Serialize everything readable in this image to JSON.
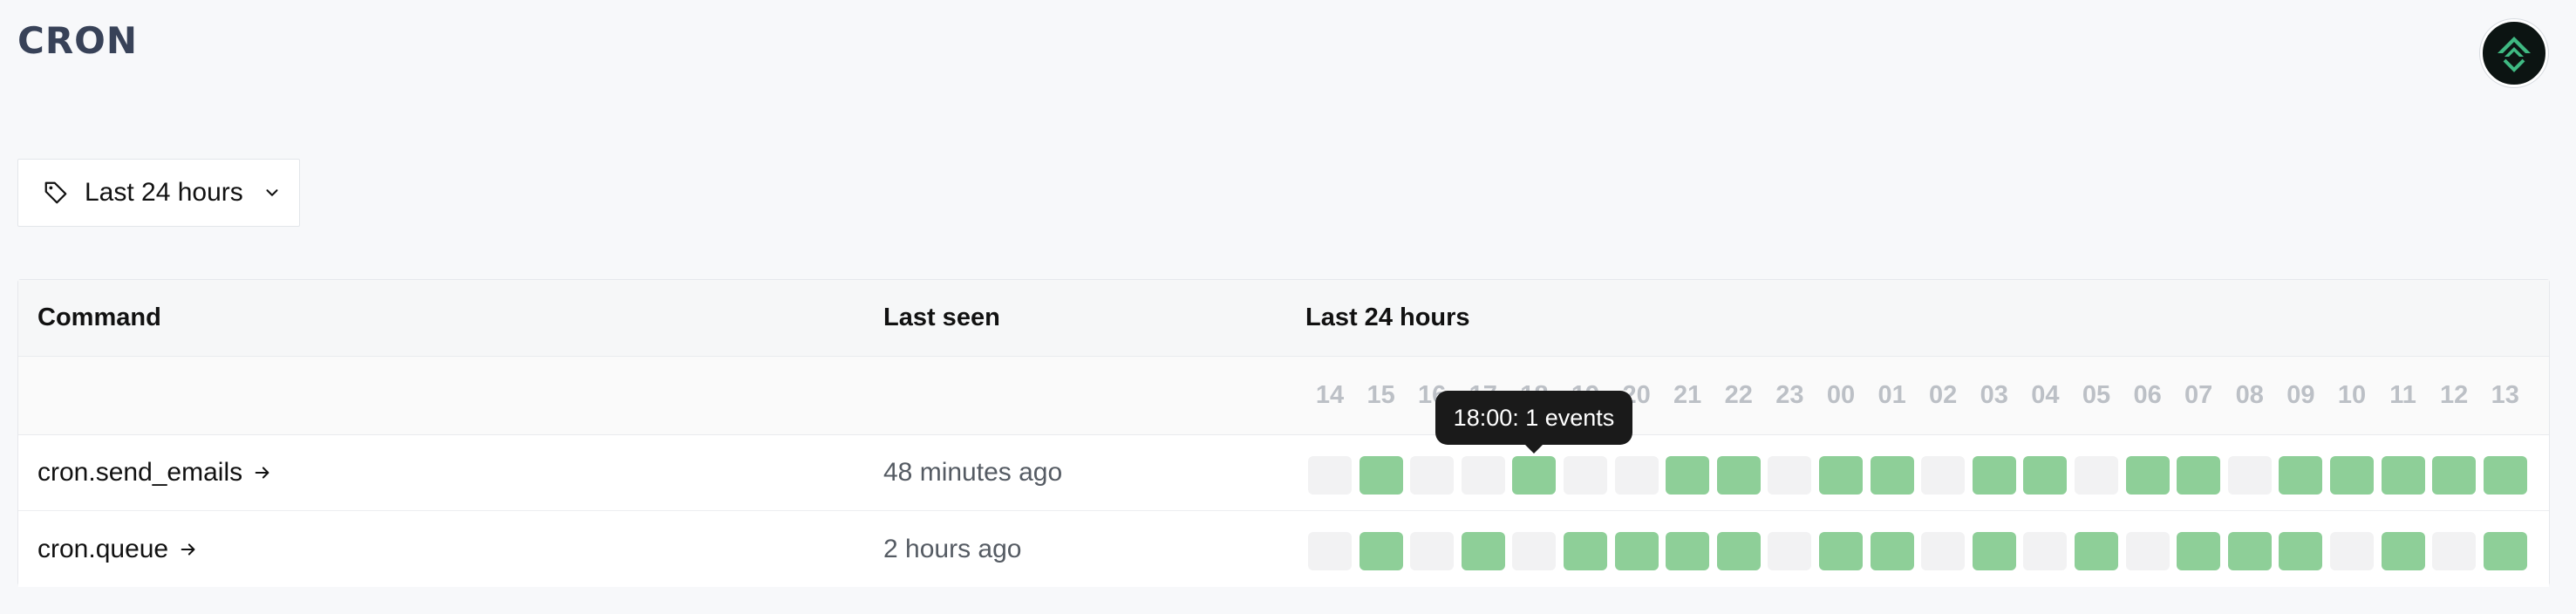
{
  "app": {
    "title": "CRON"
  },
  "filter": {
    "label": "Last 24 hours",
    "icon": "tag-icon"
  },
  "table": {
    "headers": {
      "command": "Command",
      "last_seen": "Last seen",
      "grid": "Last 24 hours"
    },
    "hours": [
      "14",
      "15",
      "16",
      "17",
      "18",
      "19",
      "20",
      "21",
      "22",
      "23",
      "00",
      "01",
      "02",
      "03",
      "04",
      "05",
      "06",
      "07",
      "08",
      "09",
      "10",
      "11",
      "12",
      "13"
    ],
    "rows": [
      {
        "command": "cron.send_emails",
        "last_seen": "48 minutes ago",
        "activity": [
          0,
          1,
          0,
          0,
          1,
          0,
          0,
          1,
          1,
          0,
          1,
          1,
          0,
          1,
          1,
          0,
          1,
          1,
          0,
          1,
          1,
          1,
          1,
          1
        ]
      },
      {
        "command": "cron.queue",
        "last_seen": "2 hours ago",
        "activity": [
          0,
          1,
          0,
          1,
          0,
          1,
          1,
          1,
          1,
          0,
          1,
          1,
          0,
          1,
          0,
          1,
          0,
          1,
          1,
          1,
          0,
          1,
          0,
          1
        ]
      }
    ]
  },
  "tooltip": {
    "text": "18:00: 1 events"
  },
  "colors": {
    "active": "#8ecf98",
    "inactive": "#f2f2f3",
    "title": "#384258"
  }
}
